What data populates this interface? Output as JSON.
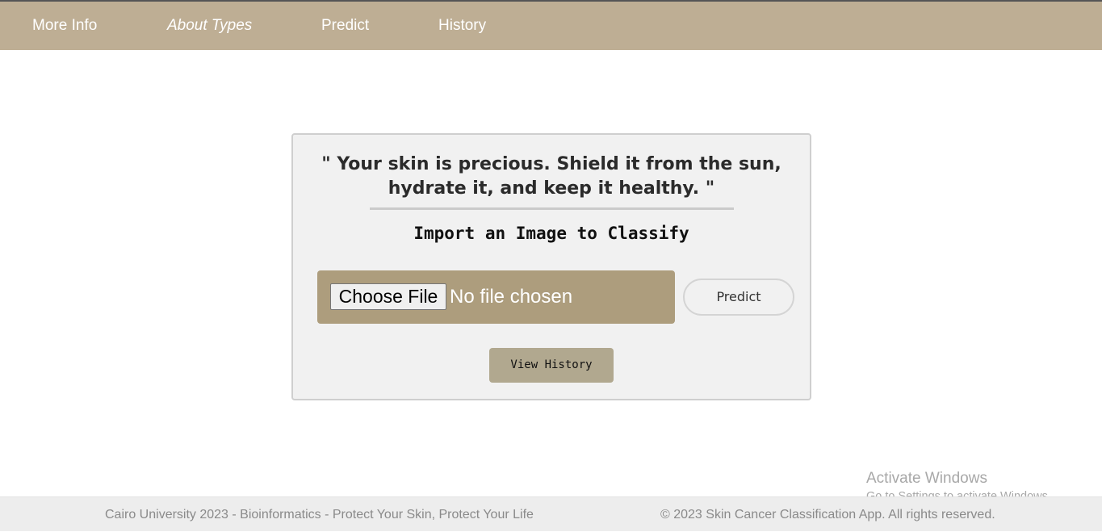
{
  "nav": {
    "items": [
      {
        "label": "More Info"
      },
      {
        "label": "About Types"
      },
      {
        "label": "Predict"
      },
      {
        "label": "History"
      }
    ]
  },
  "card": {
    "quote": "\" Your skin is precious. Shield it from the sun, hydrate it, and keep it healthy. \"",
    "subtitle": "Import an Image to Classify",
    "file_input": {
      "button_label": "Choose File",
      "status": "No file chosen"
    },
    "predict_label": "Predict",
    "history_label": "View History"
  },
  "footer": {
    "left": "Cairo University 2023 - Bioinformatics - Protect Your Skin, Protect Your Life",
    "right": "© 2023 Skin Cancer Classification App. All rights reserved."
  },
  "watermark": {
    "title": "Activate Windows",
    "subtitle": "Go to Settings to activate Windows."
  },
  "colors": {
    "navbar": "#beae94",
    "file_box": "#ad9d7d",
    "history_button": "#b1a88f"
  }
}
